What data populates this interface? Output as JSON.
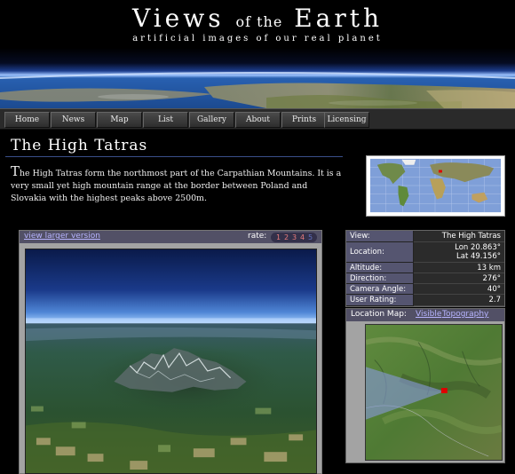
{
  "site": {
    "title_views": "Views",
    "title_of_the": "of the",
    "title_earth": "Earth",
    "tagline": "artificial images of our real planet"
  },
  "nav": [
    "Home",
    "News",
    "Map",
    "List",
    "Gallery",
    "About",
    "Prints",
    "Licensing"
  ],
  "page": {
    "title": "The High Tatras",
    "intro_dropcap": "T",
    "intro_text": "he High Tatras form the northmost part of the Carpathian Mountains. It is a very small yet high mountain range at the border between Poland and Slovakia with the highest peaks above 2500m."
  },
  "viewer": {
    "larger_link": "view larger version",
    "rate_label": "rate:",
    "rating_options": [
      "1",
      "2",
      "3",
      "4",
      "5"
    ]
  },
  "info": {
    "view_label": "View:",
    "view_value": "The High Tatras",
    "location_label": "Location:",
    "lon": "Lon 20.863°",
    "lat": "Lat 49.156°",
    "altitude_label": "Altitude:",
    "altitude_value": "13 km",
    "direction_label": "Direction:",
    "direction_value": "276°",
    "angle_label": "Camera Angle:",
    "angle_value": "40°",
    "rating_label": "User Rating:",
    "rating_value": "2.7"
  },
  "location_map": {
    "label": "Location Map:",
    "visible": "Visible",
    "topography": "Topography"
  },
  "colors": {
    "link": "#b7b4ff",
    "panel_bar": "#525066",
    "rule": "#3a4f8a",
    "marker": "#e00000"
  }
}
